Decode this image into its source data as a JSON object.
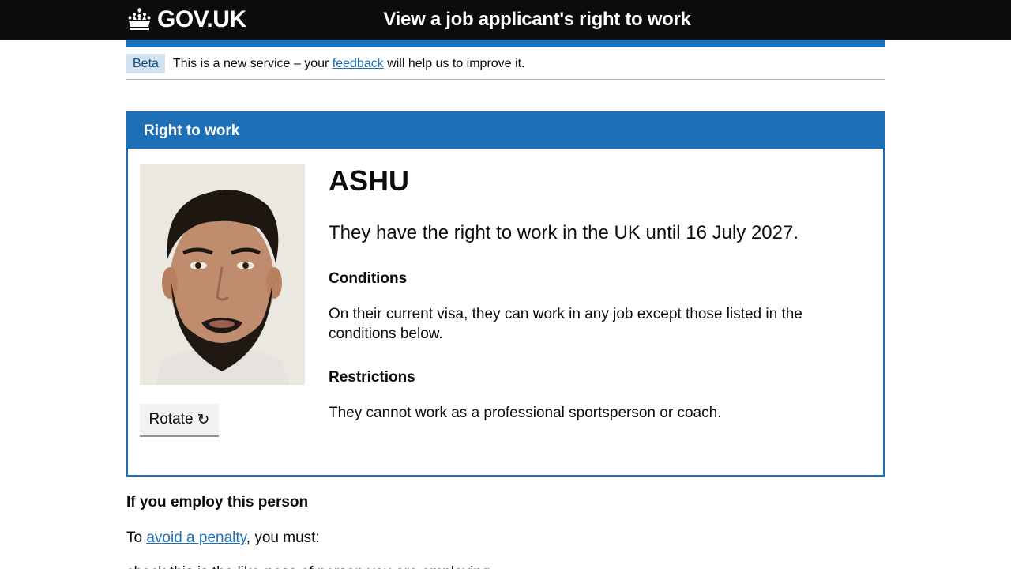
{
  "header": {
    "logo_text": "GOV.UK",
    "service_name": "View a job applicant's right to work",
    "colors": {
      "bar": "#0b0c0c",
      "accent": "#1d70b8"
    }
  },
  "phase_banner": {
    "tag": "Beta",
    "text_before": "This is a new service – your",
    "link": "feedback",
    "text_after": "will help us to improve it."
  },
  "panel": {
    "heading": "Right to work",
    "person_name": "ASHU",
    "status": "They have the right to work in the UK until 16 July 2027.",
    "conditions_heading": "Conditions",
    "conditions_text": "On their current visa, they can work in any job except those listed in the conditions below.",
    "restrictions_heading": "Restrictions",
    "restrictions_text": "They cannot work as a professional sportsperson or coach.",
    "rotate_button": "Rotate",
    "rotate_icon": "rotate-clockwise-icon"
  },
  "employ": {
    "heading": "If you employ this person",
    "text_before": "To",
    "link": "avoid a penalty",
    "text_after": ", you must:",
    "list_first_item_partial": "check this is the like-ness of person you are employing"
  }
}
